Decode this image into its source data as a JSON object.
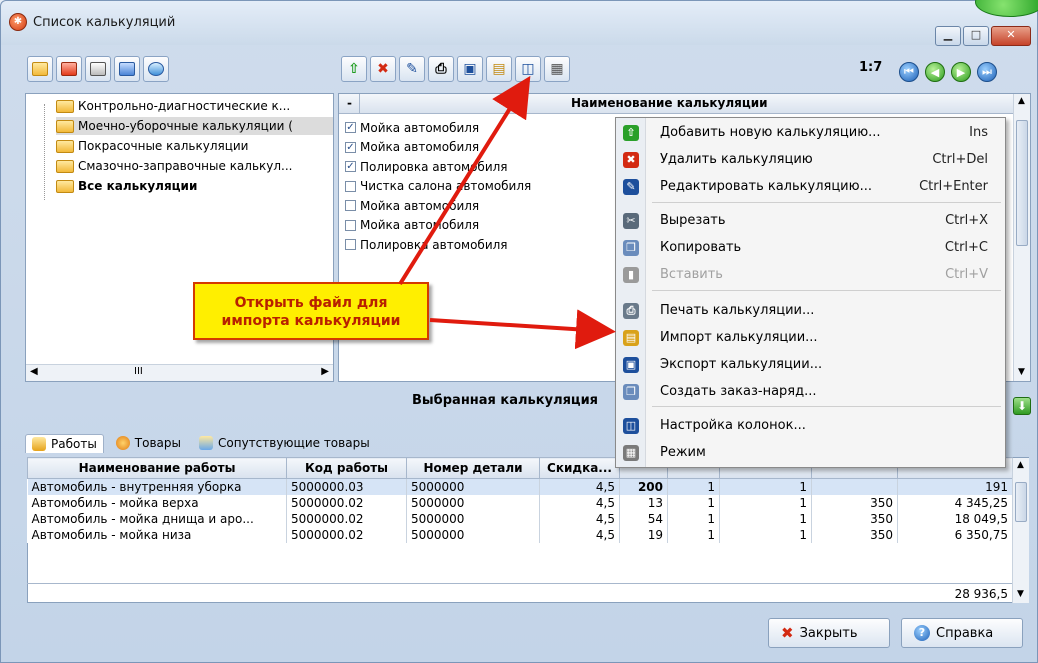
{
  "window": {
    "title": "Список калькуляций",
    "min_label": "▁",
    "max_label": "□",
    "close_label": "✕"
  },
  "pager": {
    "text": "1:7"
  },
  "tree": {
    "items": [
      {
        "label": "Контрольно-диагностические к..."
      },
      {
        "label": "Моечно-уборочные калькуляции ("
      },
      {
        "label": "Покрасочные калькуляции"
      },
      {
        "label": "Смазочно-заправочные калькул..."
      },
      {
        "label": "Все калькуляции"
      }
    ],
    "scroll_mark": "III"
  },
  "list": {
    "header": "Наименование калькуляции",
    "menu_col": "-",
    "rows": [
      {
        "label": "Мойка автомобиля",
        "checked": true
      },
      {
        "label": "Мойка автомобиля",
        "checked": true
      },
      {
        "label": "Полировка автомобиля",
        "checked": true
      },
      {
        "label": "Чистка салона автомобиля",
        "checked": false
      },
      {
        "label": "Мойка автомобиля",
        "checked": false
      },
      {
        "label": "Мойка автомобиля",
        "checked": false
      },
      {
        "label": "Полировка автомобиля",
        "checked": false
      }
    ]
  },
  "callout": {
    "line1": "Открыть файл для",
    "line2": "импорта калькуляции"
  },
  "context_menu": {
    "items": [
      {
        "label": "Добавить новую калькуляцию...",
        "shortcut": "Ins",
        "icon": "add-icon"
      },
      {
        "label": "Удалить калькуляцию",
        "shortcut": "Ctrl+Del",
        "icon": "delete-icon"
      },
      {
        "label": "Редактировать калькуляцию...",
        "shortcut": "Ctrl+Enter",
        "icon": "edit-icon"
      },
      {
        "label": "Вырезать",
        "shortcut": "Ctrl+X",
        "icon": "cut-icon"
      },
      {
        "label": "Копировать",
        "shortcut": "Ctrl+C",
        "icon": "copy-icon"
      },
      {
        "label": "Вставить",
        "shortcut": "Ctrl+V",
        "icon": "paste-icon",
        "disabled": true
      },
      {
        "label": "Печать калькуляции...",
        "shortcut": "",
        "icon": "print-icon"
      },
      {
        "label": "Импорт калькуляции...",
        "shortcut": "",
        "icon": "import-icon"
      },
      {
        "label": "Экспорт калькуляции...",
        "shortcut": "",
        "icon": "export-icon"
      },
      {
        "label": "Создать заказ-наряд...",
        "shortcut": "",
        "icon": "order-icon"
      },
      {
        "label": "Настройка колонок...",
        "shortcut": "",
        "icon": "columns-icon"
      },
      {
        "label": "Режим",
        "shortcut": "",
        "icon": "mode-icon"
      }
    ]
  },
  "selected": {
    "title": "Выбранная калькуляция",
    "tabs": [
      {
        "label": "Работы"
      },
      {
        "label": "Товары"
      },
      {
        "label": "Сопутствующие товары"
      }
    ],
    "columns": [
      "Наименование работы",
      "Код работы",
      "Номер детали",
      "Скидка...",
      "",
      "",
      "",
      "",
      ""
    ],
    "rows": [
      [
        "Автомобиль - внутренняя уборка",
        "5000000.03",
        "5000000",
        "4,5",
        "200",
        "1",
        "1",
        "",
        "191"
      ],
      [
        "Автомобиль - мойка верха",
        "5000000.02",
        "5000000",
        "4,5",
        "13",
        "1",
        "1",
        "350",
        "4 345,25"
      ],
      [
        "Автомобиль - мойка днища и аро...",
        "5000000.02",
        "5000000",
        "4,5",
        "54",
        "1",
        "1",
        "350",
        "18 049,5"
      ],
      [
        "Автомобиль - мойка низа",
        "5000000.02",
        "5000000",
        "4,5",
        "19",
        "1",
        "1",
        "350",
        "6 350,75"
      ]
    ],
    "total": "28 936,5"
  },
  "buttons": {
    "close": "Закрыть",
    "help": "Справка"
  },
  "colors": {
    "callout_bg": "#ffef00",
    "callout_text": "#b82000",
    "arrow": "#e01b0e",
    "selection": "#d6e4f6"
  }
}
